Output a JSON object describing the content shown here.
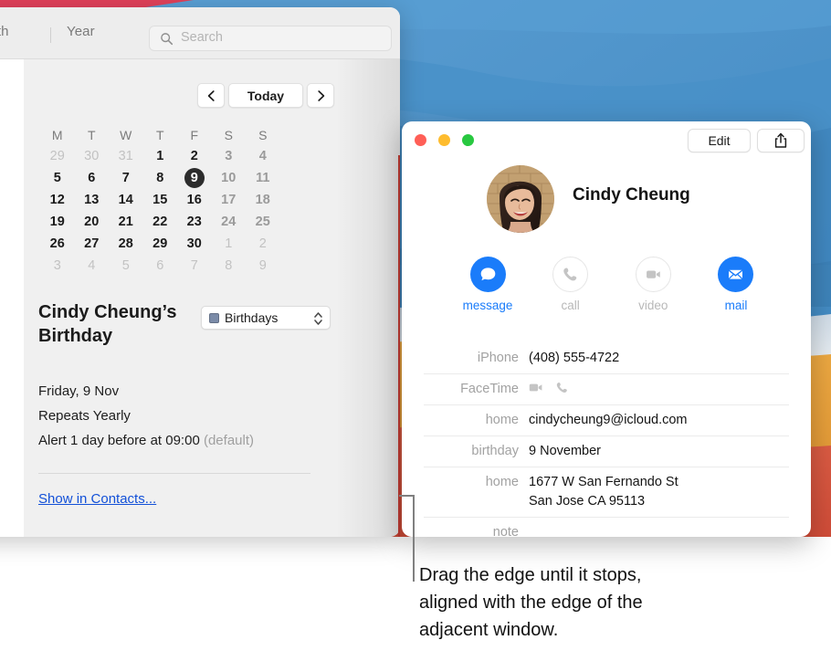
{
  "desktop": {
    "wallpaper_colors": {
      "blue_top": "#4a93cc",
      "blue_band": "#4089c4",
      "blue_deep": "#3a7fb5",
      "pale": "#d4dfe8",
      "orange": "#e8a23e",
      "red": "#d9573f",
      "red_wedge": "#e0415a"
    }
  },
  "calendar_window": {
    "toolbar": {
      "segment_month": "onth",
      "segment_year": "Year",
      "search_placeholder": "Search",
      "search_value": "",
      "search_icon": "search-icon"
    },
    "nav": {
      "prev_icon": "chevron-left-icon",
      "today_label": "Today",
      "next_icon": "chevron-right-icon"
    },
    "month_grid": {
      "weekday_headers": [
        "M",
        "T",
        "W",
        "T",
        "F",
        "S",
        "S"
      ],
      "weeks": [
        [
          {
            "n": "29",
            "kind": "out"
          },
          {
            "n": "30",
            "kind": "out"
          },
          {
            "n": "31",
            "kind": "out"
          },
          {
            "n": "1",
            "kind": "weekday"
          },
          {
            "n": "2",
            "kind": "weekday"
          },
          {
            "n": "3",
            "kind": "weekend"
          },
          {
            "n": "4",
            "kind": "weekend"
          }
        ],
        [
          {
            "n": "5",
            "kind": "weekday"
          },
          {
            "n": "6",
            "kind": "weekday"
          },
          {
            "n": "7",
            "kind": "weekday"
          },
          {
            "n": "8",
            "kind": "weekday"
          },
          {
            "n": "9",
            "kind": "today"
          },
          {
            "n": "10",
            "kind": "weekend"
          },
          {
            "n": "11",
            "kind": "weekend"
          }
        ],
        [
          {
            "n": "12",
            "kind": "weekday"
          },
          {
            "n": "13",
            "kind": "weekday"
          },
          {
            "n": "14",
            "kind": "weekday"
          },
          {
            "n": "15",
            "kind": "weekday"
          },
          {
            "n": "16",
            "kind": "weekday"
          },
          {
            "n": "17",
            "kind": "weekend"
          },
          {
            "n": "18",
            "kind": "weekend"
          }
        ],
        [
          {
            "n": "19",
            "kind": "weekday"
          },
          {
            "n": "20",
            "kind": "weekday"
          },
          {
            "n": "21",
            "kind": "weekday"
          },
          {
            "n": "22",
            "kind": "weekday"
          },
          {
            "n": "23",
            "kind": "weekday"
          },
          {
            "n": "24",
            "kind": "weekend"
          },
          {
            "n": "25",
            "kind": "weekend"
          }
        ],
        [
          {
            "n": "26",
            "kind": "weekday"
          },
          {
            "n": "27",
            "kind": "weekday"
          },
          {
            "n": "28",
            "kind": "weekday"
          },
          {
            "n": "29",
            "kind": "weekday"
          },
          {
            "n": "30",
            "kind": "weekday"
          },
          {
            "n": "1",
            "kind": "out"
          },
          {
            "n": "2",
            "kind": "out"
          }
        ],
        [
          {
            "n": "3",
            "kind": "out"
          },
          {
            "n": "4",
            "kind": "out"
          },
          {
            "n": "5",
            "kind": "out"
          },
          {
            "n": "6",
            "kind": "out"
          },
          {
            "n": "7",
            "kind": "out"
          },
          {
            "n": "8",
            "kind": "out"
          },
          {
            "n": "9",
            "kind": "out"
          }
        ]
      ]
    },
    "event": {
      "title": "Cindy Cheung’s Birthday",
      "calendar_name": "Birthdays",
      "calendar_color": "#7b8ba8",
      "date": "Friday, 9 Nov",
      "repeat": "Repeats Yearly",
      "alert": "Alert 1 day before at 09:00",
      "alert_suffix": "(default)",
      "show_in_contacts": "Show in Contacts..."
    }
  },
  "contact_window": {
    "traffic_lights": {
      "close": "#ff5f57",
      "minimize": "#febc2e",
      "zoom": "#28c840"
    },
    "edit_label": "Edit",
    "share_icon": "share-icon",
    "name": "Cindy Cheung",
    "actions": [
      {
        "label": "message",
        "icon": "message-bubble-icon",
        "enabled": true
      },
      {
        "label": "call",
        "icon": "phone-icon",
        "enabled": false
      },
      {
        "label": "video",
        "icon": "video-camera-icon",
        "enabled": false
      },
      {
        "label": "mail",
        "icon": "envelope-icon",
        "enabled": true
      }
    ],
    "accent_color": "#1a7cfa",
    "fields": [
      {
        "label": "iPhone",
        "value": "(408) 555-4722",
        "type": "text"
      },
      {
        "label": "FaceTime",
        "value": "",
        "type": "icons"
      },
      {
        "label": "home",
        "value": "cindycheung9@icloud.com",
        "type": "text"
      },
      {
        "label": "birthday",
        "value": "9 November",
        "type": "text"
      },
      {
        "label": "home",
        "value": "1677 W San Fernando St",
        "value2": "San Jose CA 95113",
        "type": "text"
      },
      {
        "label": "note",
        "value": "",
        "type": "text"
      }
    ]
  },
  "annotation": {
    "caption_line1": "Drag the edge until it stops,",
    "caption_line2": "aligned with the edge of the",
    "caption_line3": "adjacent window.",
    "leader_color": "#808080",
    "drag_edge_color": "#a8322b"
  }
}
